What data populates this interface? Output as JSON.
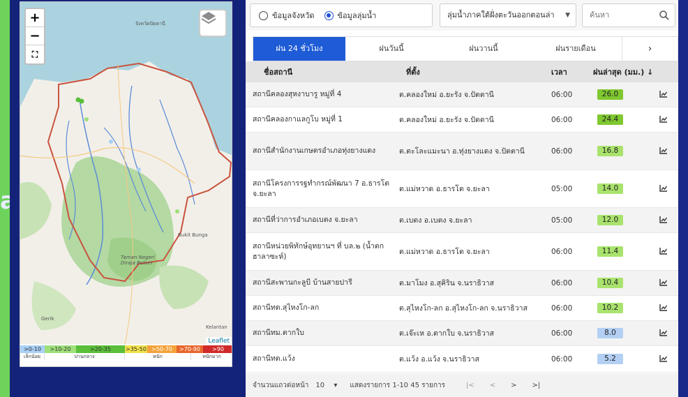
{
  "side_letter": "a",
  "map": {
    "zoom_in": "+",
    "zoom_out": "−",
    "fullscreen": "⛶",
    "attribution": "Leaflet",
    "legend_ranges": [
      {
        "label": ">0-10",
        "color": "#a9d0f5"
      },
      {
        "label": ">10-20",
        "color": "#9fe07a"
      },
      {
        "label": ">20-35",
        "color": "#5bbf3a"
      },
      {
        "label": ">35-50",
        "color": "#f3e14a"
      },
      {
        "label": ">50-70",
        "color": "#f4a23b"
      },
      {
        "label": ">70-90",
        "color": "#e8672c"
      },
      {
        "label": ">90",
        "color": "#d02a2a"
      }
    ],
    "legend_levels": [
      "เล็กน้อย",
      "ปานกลาง",
      "หนัก",
      "หนักมาก"
    ],
    "place_labels": [
      "จังหวัดปัตตานี",
      "Taman Negeri Diraja Belum",
      "Bukit Bunga",
      "Gerik",
      "Kelantan"
    ]
  },
  "filters": {
    "radio_province": "ข้อมูลจังหวัด",
    "radio_basin": "ข้อมูลลุ่มน้ำ",
    "basin_select": "ลุ่มน้ำภาคใต้ฝั่งตะวันออกตอนล่า",
    "search_placeholder": "ค้นหา"
  },
  "tabs": [
    "ฝน 24 ชั่วโมง",
    "ฝนวันนี้",
    "ฝนวานนี้",
    "ฝนรายเดือน"
  ],
  "tab_next": "›",
  "table": {
    "headers": {
      "name": "ชื่อสถานี",
      "location": "ที่ตั้ง",
      "time": "เวลา",
      "value": "ฝนล่าสุด (มม.) ↓"
    },
    "rows": [
      {
        "name": "สถานีคลองสุหงาบารู หมู่ที่ 4",
        "location": "ต.คลองใหม่ อ.ยะรัง จ.ปัตตานี",
        "time": "06:00",
        "value": "26.0",
        "color": "#7fc830"
      },
      {
        "name": "สถานีคลองกาแลกูโบ หมู่ที่ 1",
        "location": "ต.คลองใหม่ อ.ยะรัง จ.ปัตตานี",
        "time": "06:00",
        "value": "24.4",
        "color": "#7fc830"
      },
      {
        "name": "สถานีสำนักงานเกษตรอำเภอทุ่งยางแดง",
        "location": "ต.ตะโละแมะนา อ.ทุ่งยางแดง จ.ปัตตานี",
        "time": "06:00",
        "value": "16.8",
        "color": "#a9e36d"
      },
      {
        "name": "สถานีโครงการรฐทำกรณ์พัฒนา 7 อ.ธารโต จ.ยะลา",
        "location": "ต.แม่หวาด อ.ธารโต จ.ยะลา",
        "time": "05:00",
        "value": "14.0",
        "color": "#a9e36d"
      },
      {
        "name": "สถานีที่ว่าการอำเภอเบตง จ.ยะลา",
        "location": "ต.เบตง อ.เบตง จ.ยะลา",
        "time": "05:00",
        "value": "12.0",
        "color": "#a9e36d"
      },
      {
        "name": "สถานีหน่วยพิทักษ์อุทยานฯ ที่ บล.๒ (น้ำตกฮาลาซะห์)",
        "location": "ต.แม่หวาด อ.ธารโต จ.ยะลา",
        "time": "06:00",
        "value": "11.4",
        "color": "#a9e36d"
      },
      {
        "name": "สถานีสะพานกะลูบี บ้านสายปารี",
        "location": "ต.มาโมง อ.สุคิริน จ.นราธิวาส",
        "time": "06:00",
        "value": "10.4",
        "color": "#a9e36d"
      },
      {
        "name": "สถานีทต.สุไหงโก-ลก",
        "location": "ต.สุไหงโก-ลก อ.สุไหงโก-ลก จ.นราธิวาส",
        "time": "06:00",
        "value": "10.2",
        "color": "#a9e36d"
      },
      {
        "name": "สถานีทม.ตากใบ",
        "location": "ต.เจ๊ะเห อ.ตากใบ จ.นราธิวาส",
        "time": "06:00",
        "value": "8.0",
        "color": "#b3cff3"
      },
      {
        "name": "สถานีทต.แว้ง",
        "location": "ต.แว้ง อ.แว้ง จ.นราธิวาส",
        "time": "06:00",
        "value": "5.2",
        "color": "#b3cff3"
      }
    ]
  },
  "pager": {
    "rows_per_page_label": "จำนวนแถวต่อหน้า",
    "rows_per_page": "10",
    "range_text": "แสดงรายการ 1-10 45 รายการ",
    "first": "|<",
    "prev": "<",
    "next": ">",
    "last": ">|"
  }
}
